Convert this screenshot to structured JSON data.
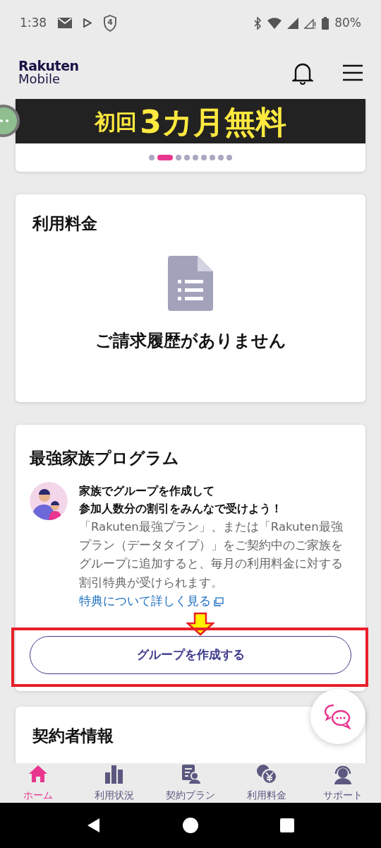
{
  "status_bar": {
    "time": "1:38",
    "shield_number": "4",
    "battery": "80%"
  },
  "header": {
    "logo_top": "Rakuten",
    "logo_bottom": "Mobile"
  },
  "banner": {
    "prefix": "初回",
    "highlight": "3カ月無料"
  },
  "carousel_dots": [
    {
      "selected": false
    },
    {
      "selected": true
    },
    {
      "selected": false
    },
    {
      "selected": false
    },
    {
      "selected": false
    },
    {
      "selected": false
    },
    {
      "selected": false
    },
    {
      "selected": false
    },
    {
      "selected": false
    }
  ],
  "billing_card": {
    "title": "利用料金",
    "empty_message": "ご請求履歴がありません"
  },
  "family_card": {
    "title": "最強家族プログラム",
    "headline": [
      "家族でグループを作成して",
      "参加人数分の割引をみんなで受けよう！"
    ],
    "description": "「Rakuten最強プラン」、または「Rakuten最強プラン（データタイプ）」をご契約中のご家族をグループに追加すると、毎月の利用料金に対する割引特典が受けられます。",
    "link": "特典について詳しく見る",
    "button": "グループを作成する"
  },
  "annotation": {
    "highlight_box": true,
    "arrow": true
  },
  "contract_card": {
    "title": "契約者情報"
  },
  "bottom_nav": [
    {
      "label": "ホーム",
      "selected": true
    },
    {
      "label": "利用状況",
      "selected": false
    },
    {
      "label": "契約プラン",
      "selected": false
    },
    {
      "label": "利用料金",
      "selected": false
    },
    {
      "label": "サポート",
      "selected": false
    }
  ]
}
